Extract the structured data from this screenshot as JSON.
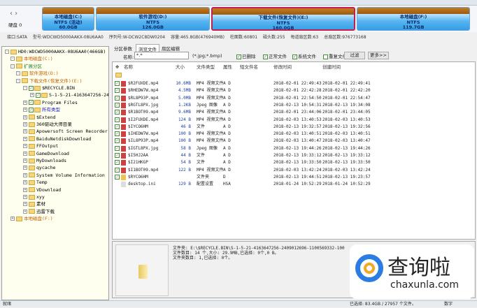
{
  "disk_panel": {
    "label": "硬盘 0",
    "partitions": [
      {
        "name": "本地磁盘(C:)",
        "fs": "NTFS (活动)",
        "size": "60.0GB"
      },
      {
        "name": "软件游戏(D:)",
        "fs": "NTFS",
        "size": "126.0GB"
      },
      {
        "name": "下载文件(恢复文件)(E:)",
        "fs": "NTFS",
        "size": "160.0GB",
        "selected": true
      },
      {
        "name": "本地磁盘(F:)",
        "fs": "NTFS",
        "size": "119.7GB"
      }
    ]
  },
  "info": [
    "接口:SATA",
    "型号:WDCWD5000AAKX-08U6AA0",
    "序列号:W-DCW2C8DW0204",
    "容量:465.8GB(476940MB)",
    "柱面数:60801",
    "磁头数:255",
    "每道扇区数:63",
    "总扇区数:976773168"
  ],
  "tree": {
    "items": [
      {
        "label": "HD0:WDCWD5000AAKX-08U6AA0(466GB)",
        "color": "#000"
      },
      {
        "label": "本地磁盘(C:)",
        "color": "#c06000"
      },
      {
        "label": "扩展分区",
        "color": "#208020"
      },
      {
        "label": "软件游戏(D:)",
        "color": "#c06000"
      },
      {
        "label": "下载文件(恢复文件)(E:)",
        "color": "#c06000"
      },
      {
        "label": "$RECYCLE.BIN",
        "color": "#000"
      },
      {
        "label": "S-1-5-21-4163647256-24",
        "color": "#000"
      },
      {
        "label": "Program Files",
        "color": "#000"
      },
      {
        "label": "所有类型",
        "color": "#2020c0"
      },
      {
        "label": "$Extend",
        "color": "#000"
      },
      {
        "label": "360驱动大师目录",
        "color": "#000"
      },
      {
        "label": "Apowersoft Screen Recorder T",
        "color": "#000"
      },
      {
        "label": "BaiduNetdiskDownload",
        "color": "#000"
      },
      {
        "label": "FFOutput",
        "color": "#000"
      },
      {
        "label": "GameDownload",
        "color": "#000"
      },
      {
        "label": "MyDownloads",
        "color": "#000"
      },
      {
        "label": "qycache",
        "color": "#000"
      },
      {
        "label": "System Volume Information",
        "color": "#000"
      },
      {
        "label": "Temp",
        "color": "#000"
      },
      {
        "label": "VDownload",
        "color": "#000"
      },
      {
        "label": "xyy",
        "color": "#000"
      },
      {
        "label": "素材",
        "color": "#000"
      },
      {
        "label": "迅雷下载",
        "color": "#000"
      },
      {
        "label": "本地磁盘(F:)",
        "color": "#c06000"
      }
    ]
  },
  "tabs": [
    "分区参数",
    "浏览文件",
    "扇区编辑"
  ],
  "filter": {
    "name_label": "名称:",
    "name_value": "*.*",
    "hint": "(*.jpg;*.bmp)",
    "checks": [
      {
        "label": "已删除",
        "checked": true
      },
      {
        "label": "正常文件",
        "checked": true
      },
      {
        "label": "系统文件",
        "checked": true
      },
      {
        "label": "重复文件",
        "checked": false
      }
    ],
    "filter_btn": "过滤",
    "more_btn": "更多>>"
  },
  "columns": [
    "名称",
    "大小",
    "文件类型",
    "属性",
    "短文件名",
    "修改时间",
    "创建时间"
  ],
  "files": [
    {
      "name": "$R2FUXDE.mp4",
      "size": "10.6MB",
      "type": "MP4 视频文件",
      "attr": "A D",
      "mtime": "2018-02-01 22:49:43",
      "ctime": "2018-02-01 22:49:41"
    },
    {
      "name": "$RHEDW7W.mp4",
      "size": "4.5MB",
      "type": "MP4 视频文件",
      "attr": "A D",
      "mtime": "2018-02-01 22:42:28",
      "ctime": "2018-02-01 22:42:20"
    },
    {
      "name": "$RL8P93P.mp4",
      "size": "5.0MB",
      "type": "MP4 视频文件",
      "attr": "A D",
      "mtime": "2018-02-01 22:54:50",
      "ctime": "2018-02-01 22:54:47"
    },
    {
      "name": "$RGTL8PX.jpg",
      "size": "1.2KB",
      "type": "Jpeg 图像",
      "attr": "A D",
      "mtime": "2018-02-13 10:54:31",
      "ctime": "2018-02-13 19:34:08"
    },
    {
      "name": "$R1BOT09.mp4",
      "size": "9.6MB",
      "type": "MP4 视频文件",
      "attr": "A D",
      "mtime": "2018-02-01 23:44:06",
      "ctime": "2018-02-01 23:44:05"
    },
    {
      "name": "$I2FUXDE.mp4",
      "size": "124 B",
      "type": "MP4 视频文件",
      "attr": "A D",
      "mtime": "2018-02-03 13:40:53",
      "ctime": "2018-02-03 13:40:53"
    },
    {
      "name": "$IYCO6HM",
      "size": "46 B",
      "type": "文件",
      "attr": "A D",
      "mtime": "2018-02-13 19:32:57",
      "ctime": "2018-02-13 19:32:56"
    },
    {
      "name": "$IHEDW7W.mp4",
      "size": "100 B",
      "type": "MP4 视频文件",
      "attr": "A D",
      "mtime": "2018-02-03 13:40:51",
      "ctime": "2018-02-03 13:40:51"
    },
    {
      "name": "$IL8P93P.mp4",
      "size": "100 B",
      "type": "MP4 视频文件",
      "attr": "A D",
      "mtime": "2018-02-03 13:40:47",
      "ctime": "2018-02-03 13:40:47"
    },
    {
      "name": "$IGTL8PX.jpg",
      "size": "58 B",
      "type": "Jpeg 图像",
      "attr": "A D",
      "mtime": "2018-02-13 19:44:26",
      "ctime": "2018-02-13 19:44:26"
    },
    {
      "name": "$I5HJ2AA",
      "size": "44 B",
      "type": "文件",
      "attr": "A D",
      "mtime": "2018-02-13 19:33:12",
      "ctime": "2018-02-13 19:33:12"
    },
    {
      "name": "$I21HKGP",
      "size": "54 B",
      "type": "文件",
      "attr": "A D",
      "mtime": "2018-02-13 19:33:50",
      "ctime": "2018-02-13 19:33:50"
    },
    {
      "name": "$I1BOT09.mp4",
      "size": "122 B",
      "type": "MP4 视频文件",
      "attr": "A D",
      "mtime": "2018-02-03 13:42:24",
      "ctime": "2018-02-03 13:42:24"
    },
    {
      "name": "$RYCO6HM",
      "size": "",
      "type": "文件夹",
      "attr": "D",
      "mtime": "2018-02-13 19:44:51",
      "ctime": "2018-02-13 19:23:57"
    },
    {
      "name": "desktop.ini",
      "size": "129 B",
      "type": "配置设置",
      "attr": "HSA",
      "mtime": "2018-01-24 10:52:29",
      "ctime": "2018-01-24 10:52:29"
    }
  ],
  "preview": {
    "line1": "文件夹: E:\\$RECYCLE.BIN\\S-1-5-21-4163647256-2409012696-1100569332-100",
    "line2": "文件数目: 14 个,大小: 29.9MB,已选择: 0个,0 B。",
    "line3": "文件夹数目: 1,已选择: 0个。"
  },
  "status": {
    "left": "就绪",
    "selected": "已选择: 83.4GB / 27957 个文件。",
    "mode": "数字"
  },
  "watermark": {
    "cn": "查询啦",
    "url": "chaxunla.com"
  }
}
